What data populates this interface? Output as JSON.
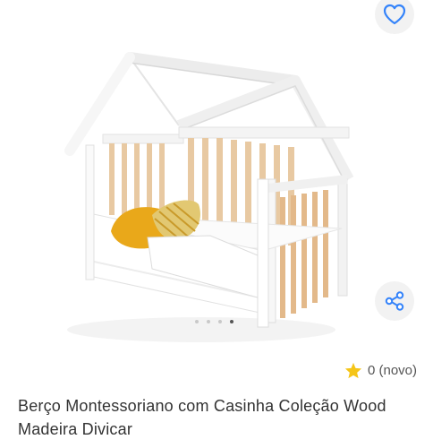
{
  "product": {
    "title": "Berço Montessoriano com Casinha Coleção Wood Madeira Divicar",
    "rating": {
      "count_label": "0 (novo)"
    }
  },
  "gallery": {
    "image_description": "product-photo-crib",
    "total_images": 4,
    "active_index": 3
  },
  "icons": {
    "favorite": "heart-icon",
    "share": "share-icon",
    "star": "star-icon"
  },
  "colors": {
    "accent": "#3483fa",
    "star": "#f5c518",
    "text": "#333333",
    "muted": "#555555"
  }
}
